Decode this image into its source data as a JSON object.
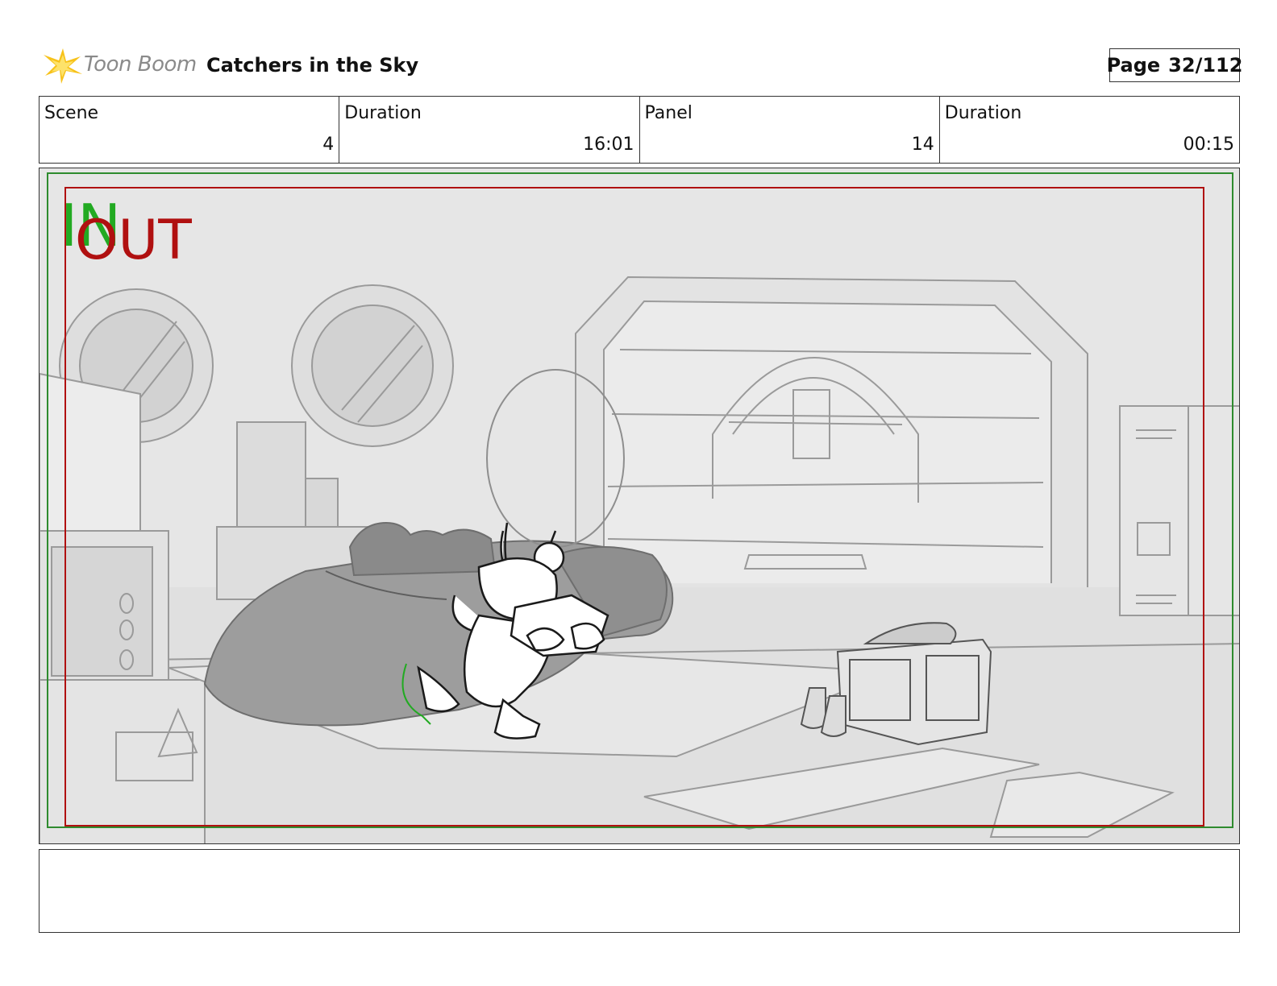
{
  "header": {
    "brand": "Toon Boom",
    "project_title": "Catchers in the Sky",
    "page_label": "Page",
    "page_number": "32/112"
  },
  "info": {
    "scene_label": "Scene",
    "scene_value": "4",
    "scene_duration_label": "Duration",
    "scene_duration_value": "16:01",
    "panel_label": "Panel",
    "panel_value": "14",
    "panel_duration_label": "Duration",
    "panel_duration_value": "00:15"
  },
  "panel": {
    "in_marker": "IN",
    "out_marker": "OUT",
    "in_color": "#22aa22",
    "out_color": "#b01010"
  },
  "notes": {
    "text": ""
  }
}
